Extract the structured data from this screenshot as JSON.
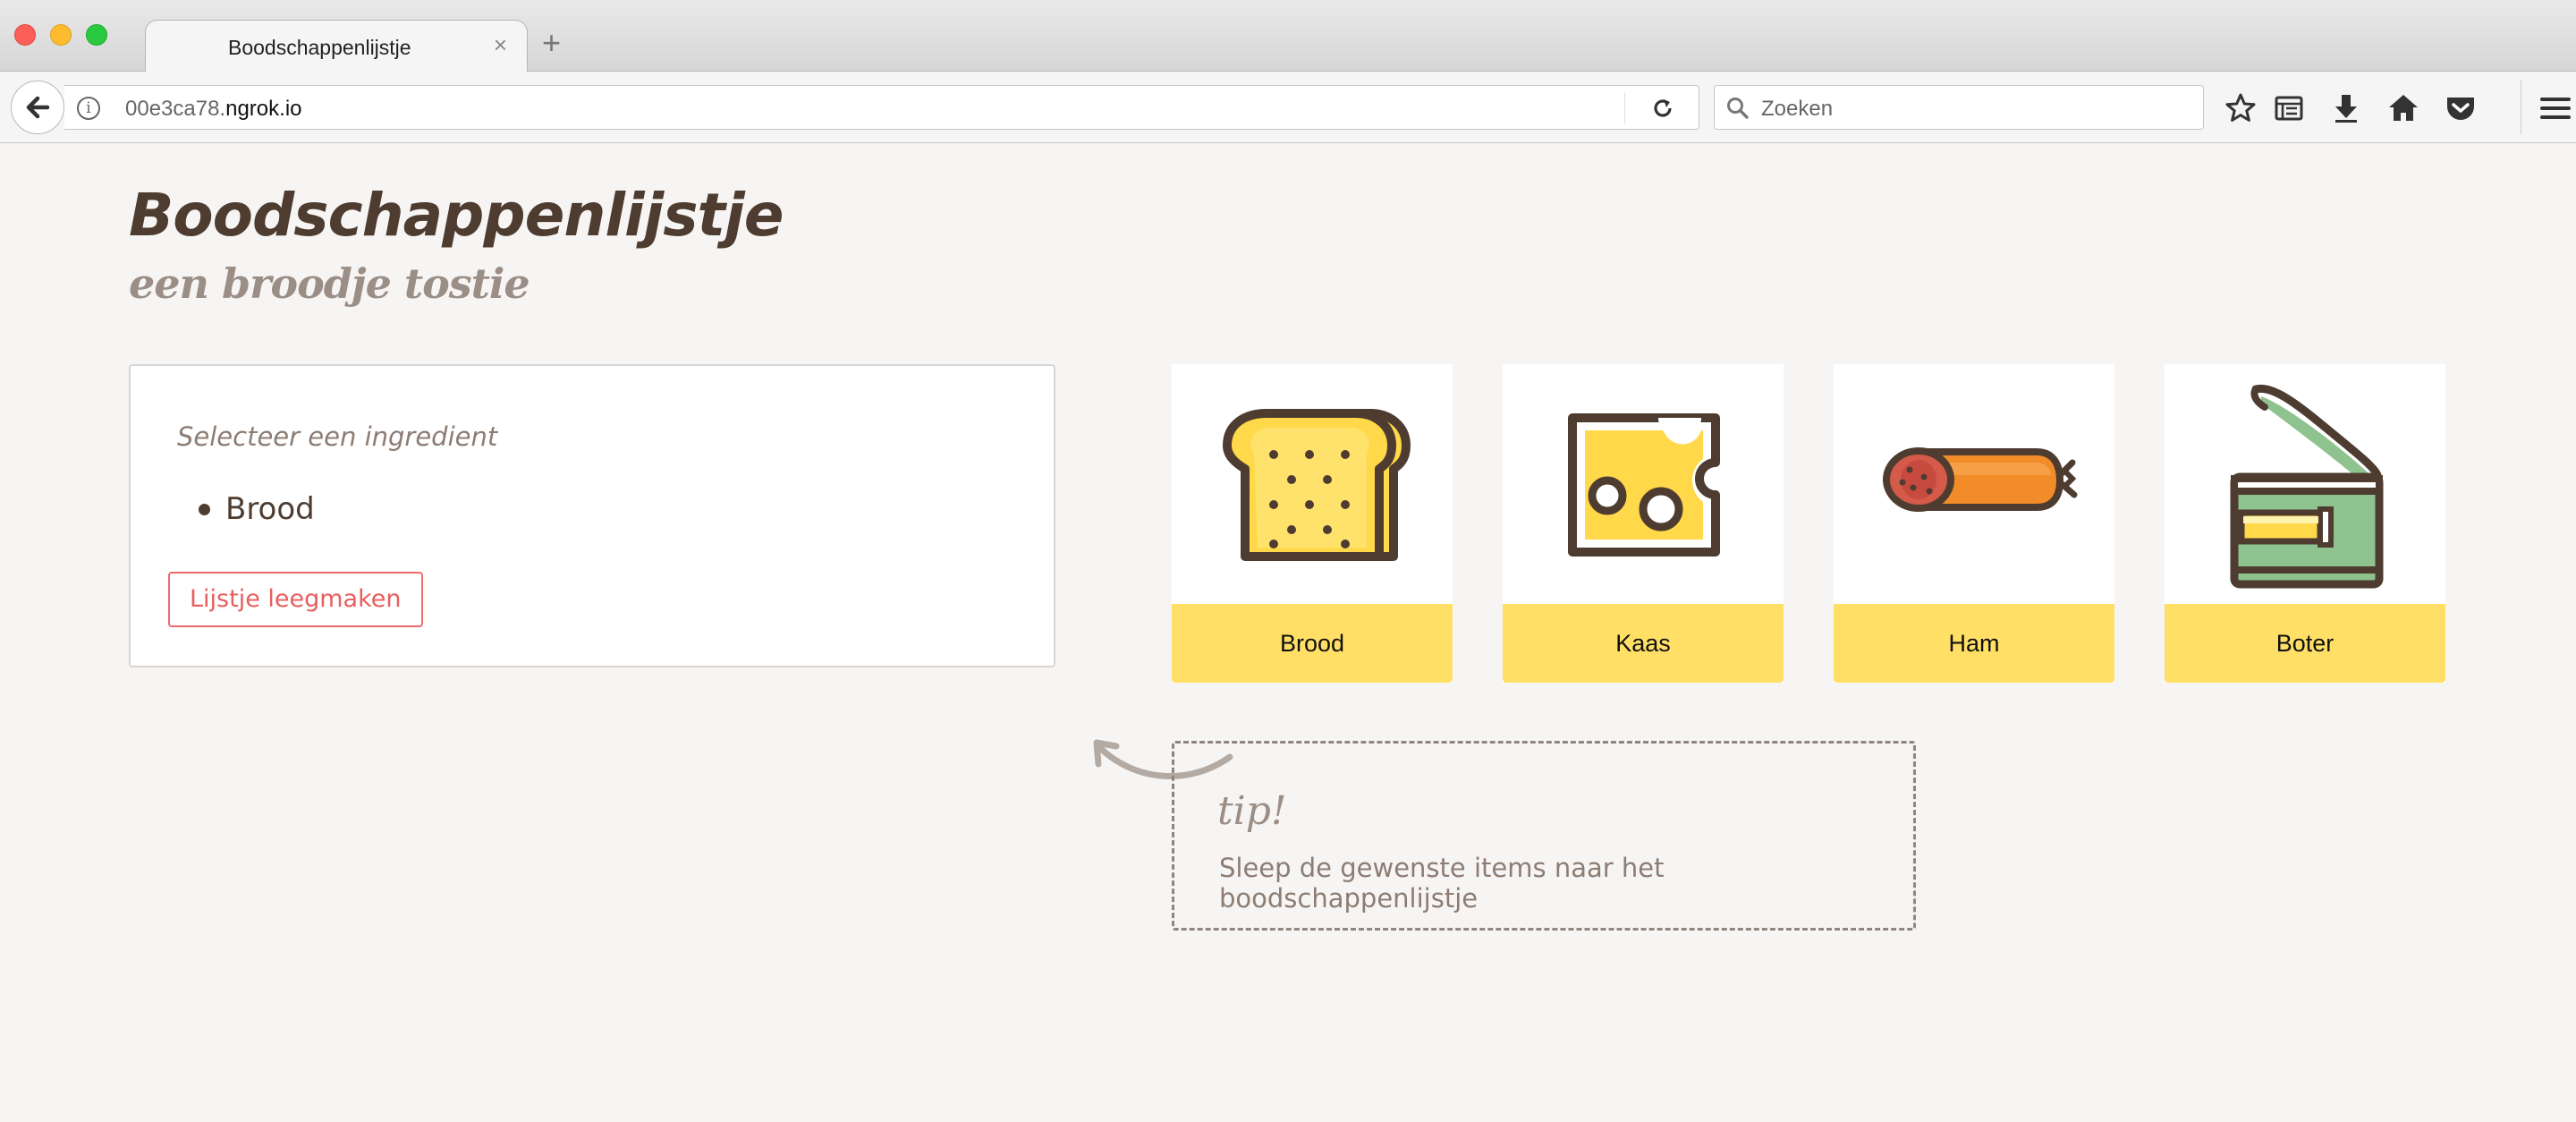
{
  "browser": {
    "tab_title": "Boodschappenlijstje",
    "tab_close": "×",
    "new_tab": "+",
    "url_host": "00e3ca78.",
    "url_domain": "ngrok.io",
    "search_placeholder": "Zoeken",
    "toolbar_icons": [
      "star-icon",
      "reading-list-icon",
      "download-icon",
      "home-icon",
      "pocket-icon",
      "hamburger-menu-icon"
    ]
  },
  "page": {
    "title": "Boodschappenlijstje",
    "subtitle": "een broodje tostie"
  },
  "shopping_list": {
    "hint": "Selecteer een ingredient",
    "items": [
      "Brood"
    ],
    "clear_button": "Lijstje leegmaken"
  },
  "ingredients": [
    {
      "label": "Brood",
      "icon": "bread-icon"
    },
    {
      "label": "Kaas",
      "icon": "cheese-icon"
    },
    {
      "label": "Ham",
      "icon": "ham-icon"
    },
    {
      "label": "Boter",
      "icon": "butter-tin-icon"
    }
  ],
  "tip": {
    "title": "tip!",
    "text": "Sleep de gewenste items naar het boodschappenlijstje"
  },
  "colors": {
    "background": "#f7f5f3",
    "card_label": "#ffdf66",
    "text_dark": "#4e3c30",
    "text_muted": "#8c7d74",
    "danger": "#e85e5e"
  }
}
